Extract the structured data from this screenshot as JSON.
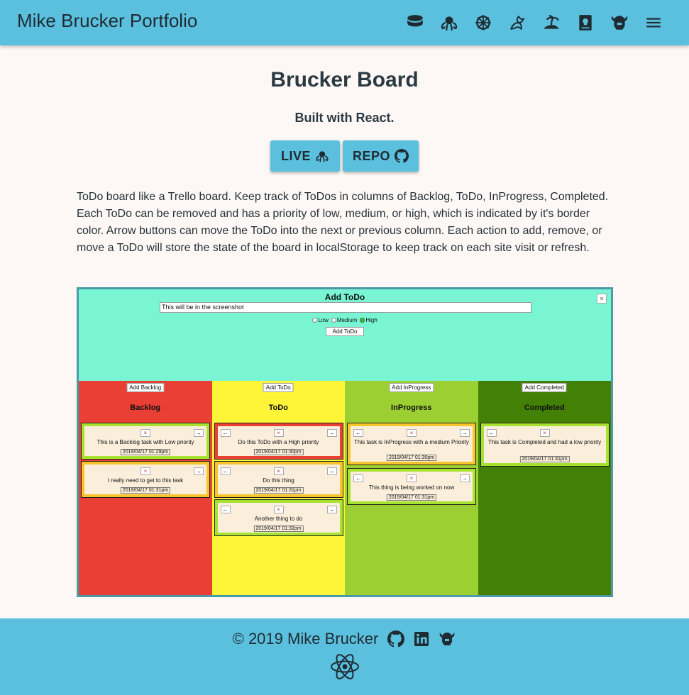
{
  "nav": {
    "brand": "Mike Brucker Portfolio",
    "icons": [
      "database-icon",
      "octopus-icon",
      "ship-wheel-icon",
      "dragon-icon",
      "island-icon",
      "book-skull-icon",
      "viking-helmet-icon",
      "menu-icon"
    ]
  },
  "project": {
    "title": "Brucker Board",
    "subtitle": "Built with React.",
    "live_label": "LIVE",
    "repo_label": "REPO",
    "description": "ToDo board like a Trello board. Keep track of ToDos in columns of Backlog, ToDo, InProgress, Completed. Each ToDo can be removed and has a priority of low, medium, or high, which is indicated by it's border color. Arrow buttons can move the ToDo into the next or previous column. Each action to add, remove, or move a ToDo will store the state of the board in localStorage to keep track on each site visit or refresh."
  },
  "screenshot": {
    "form_title": "Add ToDo",
    "close": "×",
    "input_value": "This will be in the screenshot",
    "radios": [
      {
        "label": "Low",
        "checked": false
      },
      {
        "label": "Medium",
        "checked": false
      },
      {
        "label": "High",
        "checked": true
      }
    ],
    "add_button": "Add ToDo",
    "columns": [
      {
        "add_label": "Add Backlog",
        "title": "Backlog",
        "color": "#e93f35",
        "cards": [
          {
            "text": "This is a Backlog task with Low priority",
            "date": "2019/04/17 01:29pm",
            "border": "#a7e22e",
            "left": false,
            "right": true
          },
          {
            "text": "I really need to get to this task",
            "date": "2019/04/17 01:31pm",
            "border": "#f7c52b",
            "left": false,
            "right": true
          }
        ]
      },
      {
        "add_label": "Add ToDo",
        "title": "ToDo",
        "color": "#fff538",
        "cards": [
          {
            "text": "Do this ToDo with a High priority",
            "date": "2019/04/17 01:30pm",
            "border": "#e93f35",
            "left": true,
            "right": true
          },
          {
            "text": "Do this thing",
            "date": "2019/04/17 01:31pm",
            "border": "#f7c52b",
            "left": true,
            "right": true
          },
          {
            "text": "Another thing to do",
            "date": "2019/04/17 01:32pm",
            "border": "#a7e22e",
            "left": true,
            "right": true
          }
        ]
      },
      {
        "add_label": "Add InProgress",
        "title": "InProgress",
        "color": "#9ccf32",
        "cards": [
          {
            "text": "This task is InProgress with a medium Priority",
            "date": "2019/04/17 01:30pm",
            "border": "#f7c52b",
            "left": true,
            "right": true
          },
          {
            "text": "This thing is being worked on now",
            "date": "2019/04/17 01:31pm",
            "border": "#a7e22e",
            "left": true,
            "right": true
          }
        ]
      },
      {
        "add_label": "Add Completed",
        "title": "Completed",
        "color": "#428105",
        "cards": [
          {
            "text": "This task is Completed and had a low priority",
            "date": "2019/04/17 01:31pm",
            "border": "#a7e22e",
            "left": true,
            "right": false
          }
        ]
      }
    ]
  },
  "footer": {
    "copyright": "© 2019 Mike Brucker",
    "icons": [
      "github-icon",
      "linkedin-icon",
      "viking-helmet-icon",
      "react-logo-icon"
    ]
  },
  "colors": {
    "accent": "#5bc0de",
    "background": "#fdf8f6",
    "text": "#263238",
    "screenshot_bg": "#7af5d4"
  }
}
